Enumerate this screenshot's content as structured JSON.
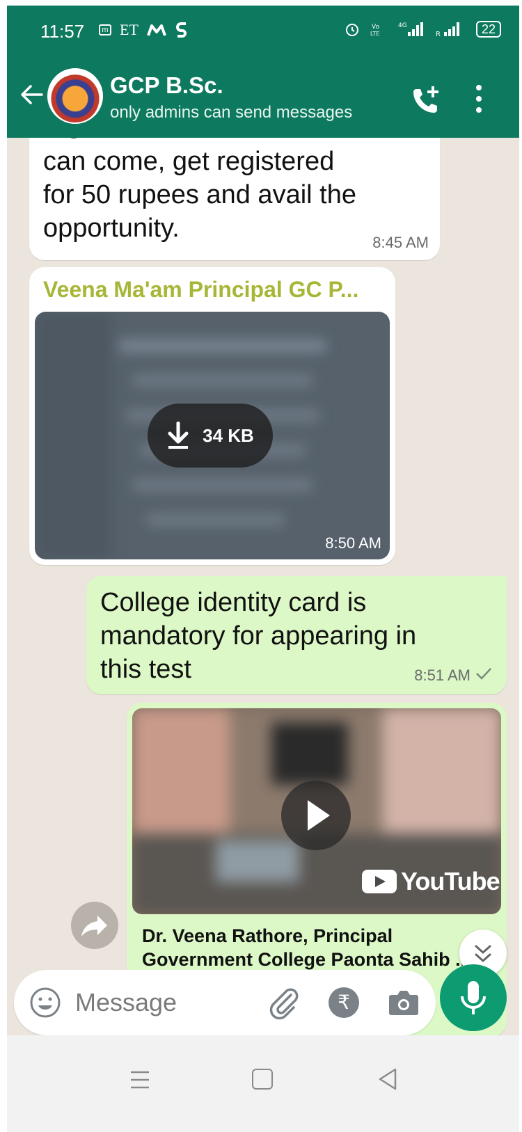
{
  "status_bar": {
    "time": "11:57",
    "left_icons": [
      "m",
      "ET"
    ],
    "battery": "22"
  },
  "header": {
    "title": "GCP B.Sc.",
    "subtitle": "only admins can send messages"
  },
  "messages": [
    {
      "type": "text",
      "lines": [
        "can come, get registered",
        "for 50 rupees and avail the",
        "opportunity."
      ],
      "time": "8:45 AM"
    },
    {
      "type": "document",
      "sender": "Veena Ma'am Principal GC P...",
      "size": "34 KB",
      "time": "8:50 AM"
    },
    {
      "type": "text",
      "lines": [
        "College identity card is",
        "mandatory for appearing in",
        "this test"
      ],
      "time": "8:51 AM"
    },
    {
      "type": "link",
      "brand": "YouTube",
      "title": "Dr. Veena Rathore, Principal Government College Paonta Sahib ..."
    }
  ],
  "composer": {
    "placeholder": "Message",
    "rupee_symbol": "₹"
  },
  "colors": {
    "header_green": "#0d7a5f",
    "outgoing_bubble": "#dcf8c6",
    "chat_background": "#ece5dd",
    "sender_name": "#a8b637",
    "mic_button": "#0d9b72"
  }
}
